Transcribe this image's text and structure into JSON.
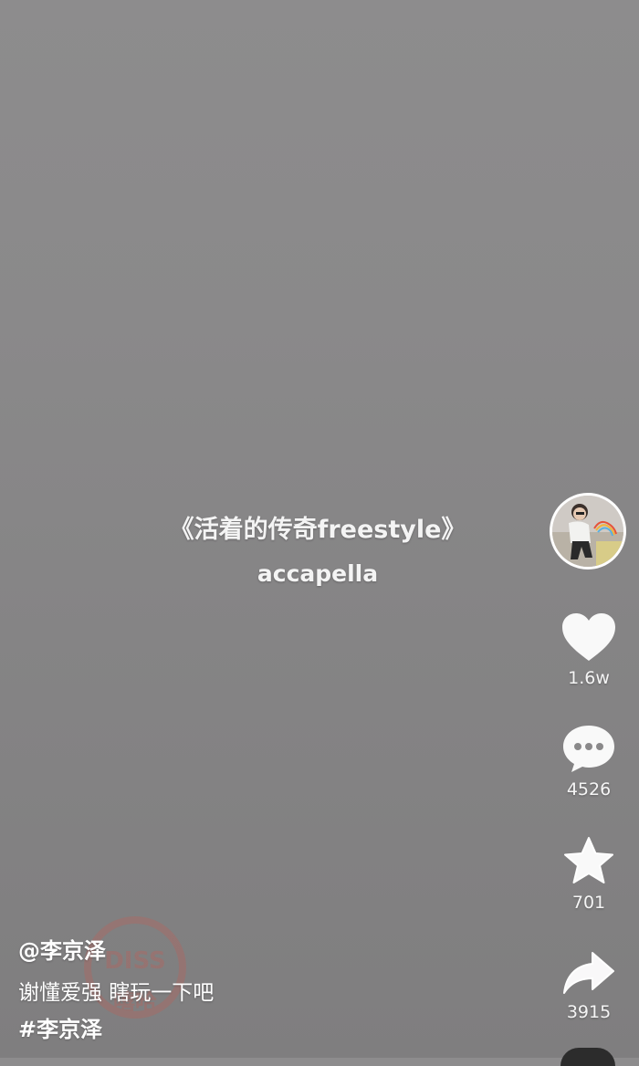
{
  "video": {
    "title_line": "《活着的传奇freestyle》",
    "subtitle_line": "accapella"
  },
  "watermark": {
    "text": "DISS",
    "sub": "嘻哈"
  },
  "rail": {
    "avatar_icon": "user-avatar",
    "like": {
      "icon": "heart-icon",
      "count": "1.6w"
    },
    "comment": {
      "icon": "comment-bubble-icon",
      "count": "4526"
    },
    "favorite": {
      "icon": "star-icon",
      "count": "701"
    },
    "share": {
      "icon": "share-arrow-icon",
      "count": "3915"
    }
  },
  "post": {
    "author": "@李京泽",
    "caption": "谢懂爱强 瞎玩一下吧",
    "hashtag": "#李京泽"
  },
  "colors": {
    "background": "#8a898a",
    "text": "#ffffff",
    "watermark": "#c85a50"
  }
}
